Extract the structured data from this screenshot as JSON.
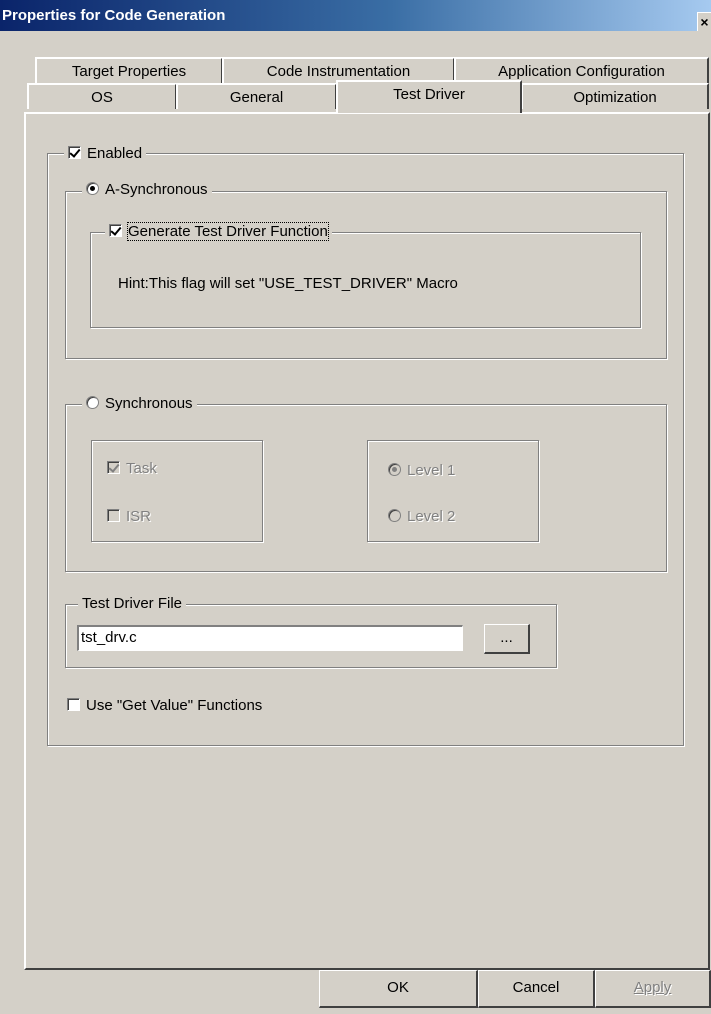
{
  "window": {
    "title": "Properties for Code Generation",
    "close_label": "×"
  },
  "tabs": {
    "row1": [
      "Target Properties",
      "Code Instrumentation",
      "Application Configuration"
    ],
    "row2": [
      "OS",
      "General",
      "Test Driver",
      "Optimization"
    ],
    "active": "Test Driver"
  },
  "enabled": {
    "label": "Enabled",
    "checked": true
  },
  "async": {
    "label": "A-Synchronous",
    "selected": true,
    "generate": {
      "label": "Generate Test  Driver Function",
      "checked": true
    },
    "hint": "Hint:This flag will set \"USE_TEST_DRIVER\" Macro"
  },
  "sync": {
    "label": "Synchronous",
    "selected": false,
    "task": {
      "label": "Task",
      "checked": true
    },
    "isr": {
      "label": "ISR",
      "checked": false
    },
    "level1": {
      "label": "Level 1",
      "selected": true
    },
    "level2": {
      "label": "Level 2",
      "selected": false
    }
  },
  "test_driver_file": {
    "label": "Test Driver File",
    "value": "tst_drv.c",
    "browse_label": "..."
  },
  "get_value": {
    "label": "Use \"Get Value\" Functions",
    "checked": false
  },
  "buttons": {
    "ok": "OK",
    "cancel": "Cancel",
    "apply": "Apply"
  },
  "colors": {
    "title_bar": "#0a246a",
    "face": "#d4d0c8",
    "disabled_text": "#808080"
  }
}
